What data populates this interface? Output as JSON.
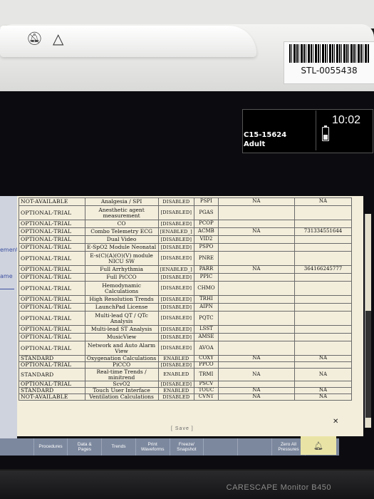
{
  "bezel": {
    "alarm_icon": "alarm-bell-crossed-icon",
    "silence_icon": "silence-triangle-icon",
    "asset_tag": "STL-0055438",
    "model": "CARESCAPE Monitor B450"
  },
  "patient": {
    "bed_id": "C15-15624",
    "category": "Adult",
    "time": "10:02",
    "battery_icon": "battery-icon"
  },
  "left_fragments": [
    "ement",
    "ame"
  ],
  "table": {
    "rows": [
      {
        "option": "NOT-AVAILABLE",
        "feature": "Analgesia / SPI",
        "status": "DISABLED",
        "code": "PSPI",
        "col5": "NA",
        "col6": "NA",
        "h": 11
      },
      {
        "option": "OPTIONAL-TRIAL",
        "feature": "Anesthetic agent measurement",
        "status": "[DISABLED]",
        "code": "PGAS",
        "col5": "",
        "col6": "",
        "h": 20
      },
      {
        "option": "OPTIONAL-TRIAL",
        "feature": "CO",
        "status": "[DISABLED]",
        "code": "PCOP",
        "col5": "",
        "col6": "",
        "h": 11
      },
      {
        "option": "OPTIONAL-TRIAL",
        "feature": "Combo Telemetry ECG",
        "status": "[ENABLED_]",
        "code": "ACMB",
        "col5": "NA",
        "col6": "731334551644",
        "h": 11
      },
      {
        "option": "OPTIONAL-TRIAL",
        "feature": "Dual Video",
        "status": "[DISABLED]",
        "code": "VID2",
        "col5": "",
        "col6": "",
        "h": 11
      },
      {
        "option": "OPTIONAL-TRIAL",
        "feature": "E-SpO2 Module Neonatal",
        "status": "[DISABLED]",
        "code": "PSPO",
        "col5": "",
        "col6": "",
        "h": 11
      },
      {
        "option": "OPTIONAL-TRIAL",
        "feature": "E-s(C)(A)(O)(V) module NICU SW",
        "status": "[DISABLED]",
        "code": "PNRE",
        "col5": "",
        "col6": "",
        "h": 20
      },
      {
        "option": "OPTIONAL-TRIAL",
        "feature": "Full Arrhythmia",
        "status": "[ENABLED_]",
        "code": "PARR",
        "col5": "NA",
        "col6": "364166245777",
        "h": 11
      },
      {
        "option": "OPTIONAL-TRIAL",
        "feature": "Full PiCCO",
        "status": "[DISABLED]",
        "code": "PPIC",
        "col5": "",
        "col6": "",
        "h": 11
      },
      {
        "option": "OPTIONAL-TRIAL",
        "feature": "Hemodynamic Calculations",
        "status": "[DISABLED]",
        "code": "CHMO",
        "col5": "",
        "col6": "",
        "h": 20
      },
      {
        "option": "OPTIONAL-TRIAL",
        "feature": "High Resolution Trends",
        "status": "[DISABLED]",
        "code": "TRHI",
        "col5": "",
        "col6": "",
        "h": 11
      },
      {
        "option": "OPTIONAL-TRIAL",
        "feature": "LaunchPad License",
        "status": "[DISABLED]",
        "code": "AIPN",
        "col5": "",
        "col6": "",
        "h": 11
      },
      {
        "option": "OPTIONAL-TRIAL",
        "feature": "Multi-lead QT / QTc Analysis",
        "status": "[DISABLED]",
        "code": "PQTC",
        "col5": "",
        "col6": "",
        "h": 20
      },
      {
        "option": "OPTIONAL-TRIAL",
        "feature": "Multi-lead ST Analysis",
        "status": "[DISABLED]",
        "code": "LSST",
        "col5": "",
        "col6": "",
        "h": 11
      },
      {
        "option": "OPTIONAL-TRIAL",
        "feature": "MusicView",
        "status": "[DISABLED]",
        "code": "AMSE",
        "col5": "",
        "col6": "",
        "h": 11
      },
      {
        "option": "OPTIONAL-TRIAL",
        "feature": "Network and Auto Alarm View",
        "status": "[DISABLED]",
        "code": "AVOA",
        "col5": "",
        "col6": "",
        "h": 20
      },
      {
        "option": "STANDARD",
        "feature": "Oxygenation Calculations",
        "status": "ENABLED",
        "code": "COXY",
        "col5": "NA",
        "col6": "NA",
        "h": 9
      },
      {
        "option": "OPTIONAL-TRIAL",
        "feature": "PiCCO",
        "status": "[DISABLED]",
        "code": "PPCO",
        "col5": "",
        "col6": "",
        "h": 9
      },
      {
        "option": "STANDARD",
        "feature": "Real-time Trends / minitrend",
        "status": "ENABLED",
        "code": "TRMI",
        "col5": "NA",
        "col6": "NA",
        "h": 18
      },
      {
        "option": "OPTIONAL-TRIAL",
        "feature": "ScvO2",
        "status": "[DISABLED]",
        "code": "PSCV",
        "col5": "",
        "col6": "",
        "h": 9
      },
      {
        "option": "STANDARD",
        "feature": "Touch User Interface",
        "status": "ENABLED",
        "code": "TOUC",
        "col5": "NA",
        "col6": "NA",
        "h": 9
      },
      {
        "option": "NOT-AVAILABLE",
        "feature": "Ventilation Calculations",
        "status": "DISABLED",
        "code": "CVNT",
        "col5": "NA",
        "col6": "NA",
        "h": 9
      }
    ],
    "save_label": "[ Save ]"
  },
  "menu": {
    "buttons": [
      "",
      "Procedures",
      "Data &\nPages",
      "Trends",
      "Print\nWaveforms",
      "Freeze/\nSnapshot",
      "",
      "",
      "Zero All\nPressures",
      ""
    ],
    "alarm_icon": "alarm-bell-icon"
  }
}
